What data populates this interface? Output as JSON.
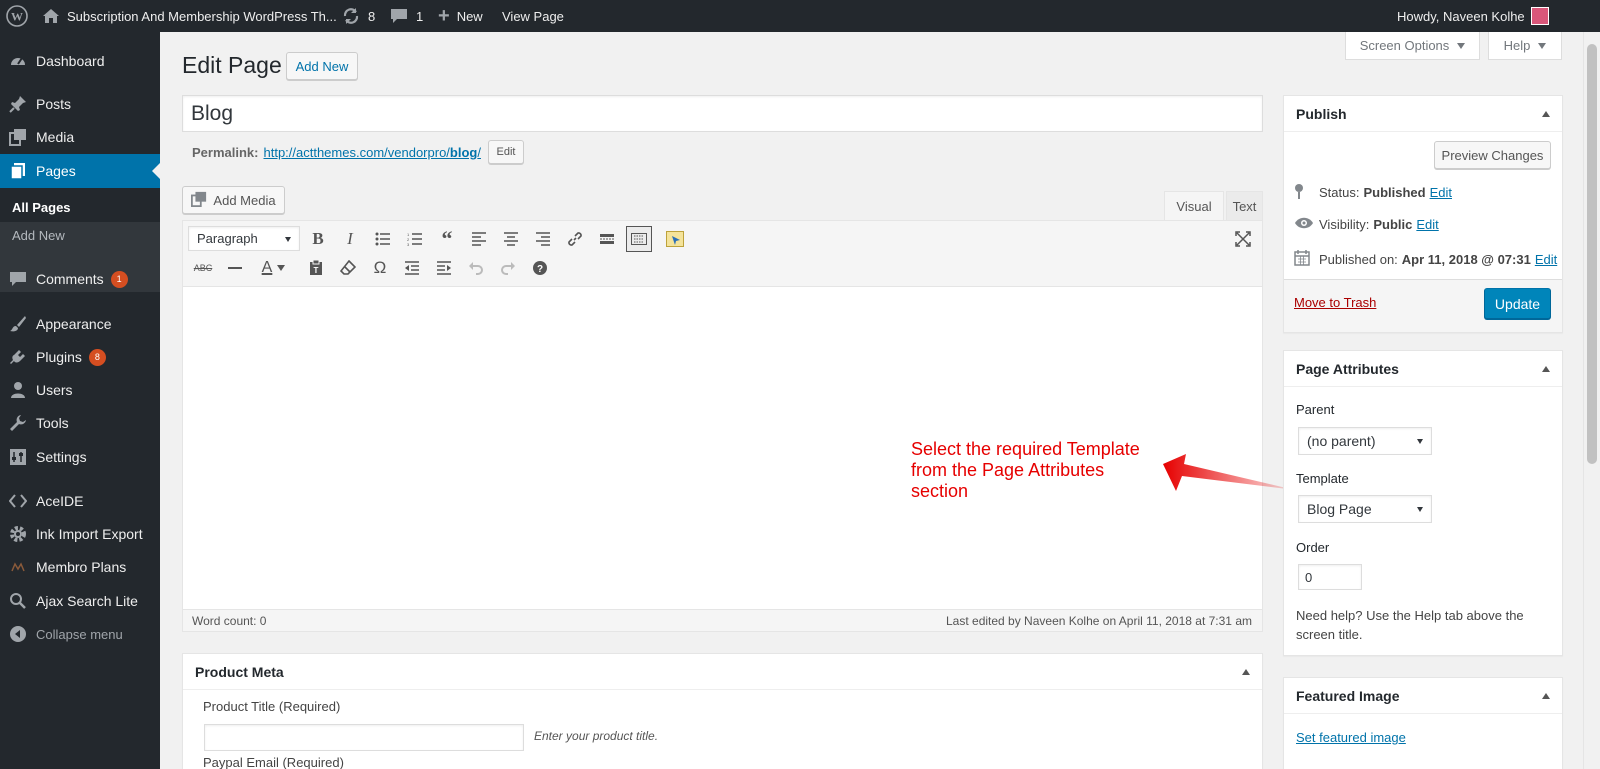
{
  "admin_bar": {
    "site_name": "Subscription And Membership WordPress Th...",
    "updates_count": "8",
    "comments_count": "1",
    "new_label": "New",
    "view_page_label": "View Page",
    "howdy": "Howdy, Naveen Kolhe"
  },
  "sidebar": {
    "items": [
      {
        "label": "Dashboard",
        "icon": "dashboard-icon"
      },
      {
        "label": "Posts",
        "icon": "pin-icon"
      },
      {
        "label": "Media",
        "icon": "media-icon"
      },
      {
        "label": "Pages",
        "icon": "pages-icon"
      },
      {
        "label": "Comments",
        "icon": "comment-icon",
        "count": "1"
      },
      {
        "label": "Appearance",
        "icon": "brush-icon"
      },
      {
        "label": "Plugins",
        "icon": "plugin-icon",
        "count": "8"
      },
      {
        "label": "Users",
        "icon": "user-icon"
      },
      {
        "label": "Tools",
        "icon": "wrench-icon"
      },
      {
        "label": "Settings",
        "icon": "settings-icon"
      },
      {
        "label": "AceIDE",
        "icon": "code-icon"
      },
      {
        "label": "Ink Import Export",
        "icon": "gear-icon"
      },
      {
        "label": "Membro Plans",
        "icon": "membro-icon"
      },
      {
        "label": "Ajax Search Lite",
        "icon": "search-icon"
      },
      {
        "label": "Collapse menu",
        "icon": "collapse-icon"
      }
    ],
    "submenu": [
      "All Pages",
      "Add New"
    ]
  },
  "screen_options_label": "Screen Options",
  "help_label": "Help",
  "page": {
    "heading": "Edit Page",
    "add_new_label": "Add New",
    "title_value": "Blog",
    "permalink_label": "Permalink:",
    "permalink_base": "http://actthemes.com/vendorpro/",
    "permalink_slug": "blog",
    "permalink_tail": "/",
    "permalink_edit": "Edit"
  },
  "editor": {
    "add_media_label": "Add Media",
    "tab_visual": "Visual",
    "tab_text": "Text",
    "format_select": "Paragraph",
    "word_count": "Word count: 0",
    "last_edited": "Last edited by Naveen Kolhe on April 11, 2018 at 7:31 am"
  },
  "annotation": {
    "line1": "Select the required Template",
    "line2": "from the Page Attributes",
    "line3": "section",
    "color": "#e60000"
  },
  "publish": {
    "title": "Publish",
    "preview_label": "Preview Changes",
    "status_label": "Status:",
    "status_value": "Published",
    "visibility_label": "Visibility:",
    "visibility_value": "Public",
    "published_label": "Published on:",
    "published_value": "Apr 11, 2018 @ 07:31",
    "edit_link": "Edit",
    "trash_label": "Move to Trash",
    "update_label": "Update"
  },
  "page_attributes": {
    "title": "Page Attributes",
    "parent_label": "Parent",
    "parent_value": "(no parent)",
    "template_label": "Template",
    "template_value": "Blog Page",
    "order_label": "Order",
    "order_value": "0",
    "help_text": "Need help? Use the Help tab above the screen title."
  },
  "featured_image": {
    "title": "Featured Image",
    "link": "Set featured image"
  },
  "product_meta": {
    "title": "Product Meta",
    "product_title_label": "Product Title (Required)",
    "product_title_hint": "Enter your product title.",
    "paypal_label": "Paypal Email (Required)"
  },
  "colors": {
    "accent": "#0073aa",
    "sidebar_bg": "#23282d",
    "badge": "#d54e21",
    "primary_button": "#0085ba"
  }
}
